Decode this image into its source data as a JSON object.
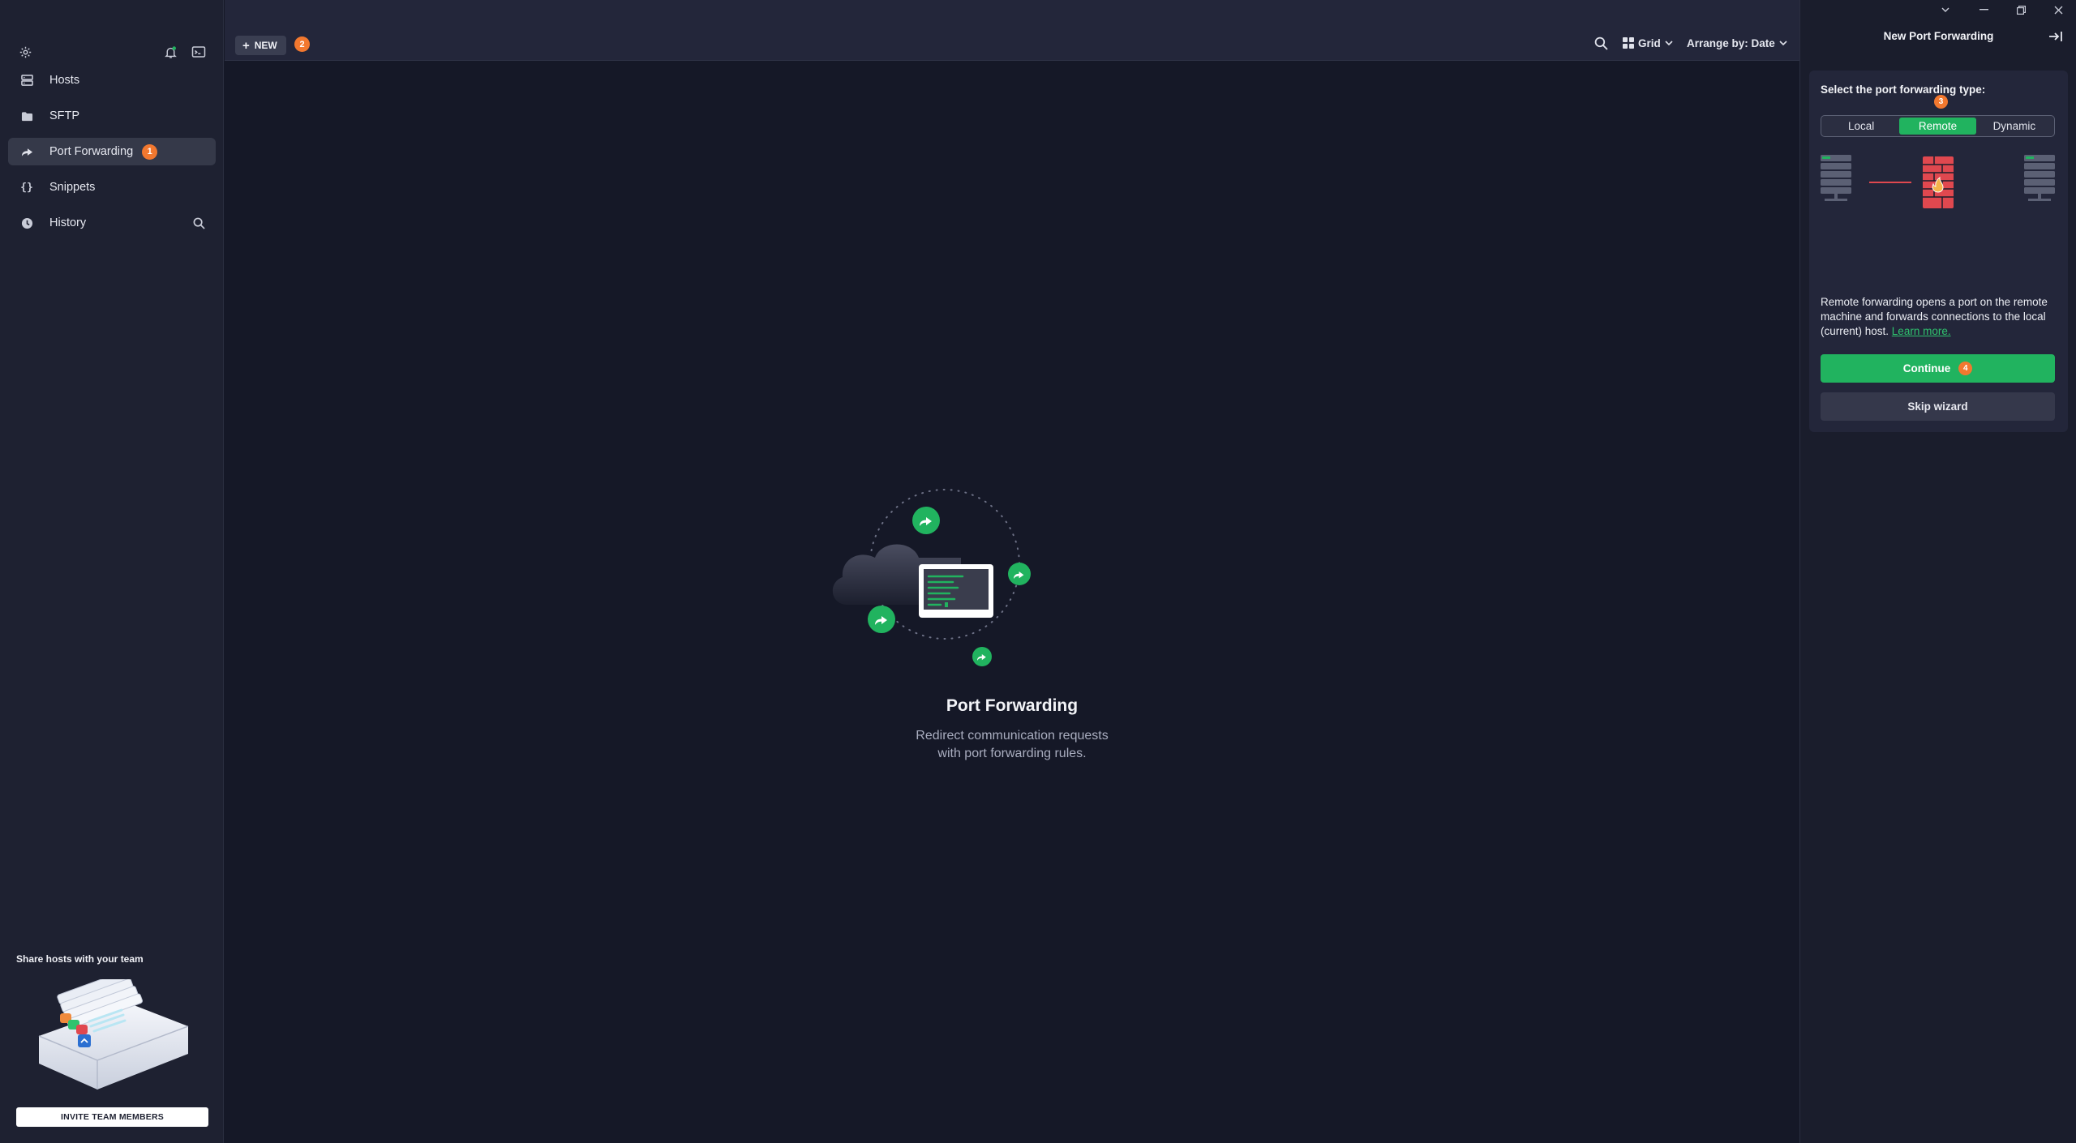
{
  "sidebar": {
    "items": [
      {
        "label": "Hosts",
        "icon": "hosts-icon"
      },
      {
        "label": "SFTP",
        "icon": "folder-icon"
      },
      {
        "label": "Port Forwarding",
        "icon": "forward-arrow-icon",
        "badge": "1"
      },
      {
        "label": "Snippets",
        "icon": "braces-icon"
      },
      {
        "label": "History",
        "icon": "clock-icon"
      }
    ],
    "share_title": "Share hosts with your team",
    "invite_button": "INVITE TEAM MEMBERS"
  },
  "topbar": {
    "new_label": "NEW",
    "new_badge": "2",
    "view_mode": "Grid",
    "arrange": "Arrange by: Date"
  },
  "main": {
    "empty_title": "Port Forwarding",
    "empty_subtitle_line1": "Redirect communication requests",
    "empty_subtitle_line2": "with port forwarding rules."
  },
  "panel": {
    "title": "New Port Forwarding",
    "select_label": "Select the port forwarding type:",
    "step_badge": "3",
    "types": [
      "Local",
      "Remote",
      "Dynamic"
    ],
    "selected_type": "Remote",
    "description": "Remote forwarding opens a port on the remote machine and forwards connections to the local (current) host.",
    "learn_more": "Learn more.",
    "continue_label": "Continue",
    "continue_badge": "4",
    "skip_label": "Skip wizard"
  },
  "colors": {
    "accent": "#21b35f",
    "badge": "#f2782f",
    "background": "#151827",
    "sidebar": "#1e2131",
    "firewall": "#e0484f"
  }
}
